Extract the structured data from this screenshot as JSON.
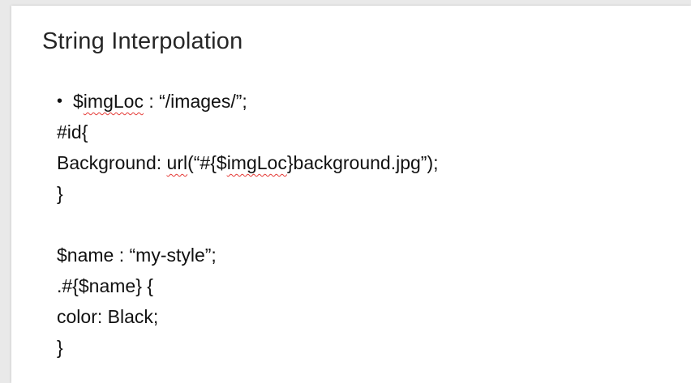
{
  "slide": {
    "title": "String Interpolation",
    "lines": {
      "l1_bullet": "•",
      "l1_a": "$",
      "l1_b": "imgLoc",
      "l1_c": " : “/images/”;",
      "l2": "#id{",
      "l3_a": "Background: ",
      "l3_b": "url",
      "l3_c": "(“#{$",
      "l3_d": "imgLoc",
      "l3_e": "}background.jpg”);",
      "l4": "}",
      "l6": "$name : “my-style”;",
      "l7": ".#{$name} {",
      "l8": "color: Black;",
      "l9": "}"
    },
    "spellcheck_color": "#e53935"
  }
}
